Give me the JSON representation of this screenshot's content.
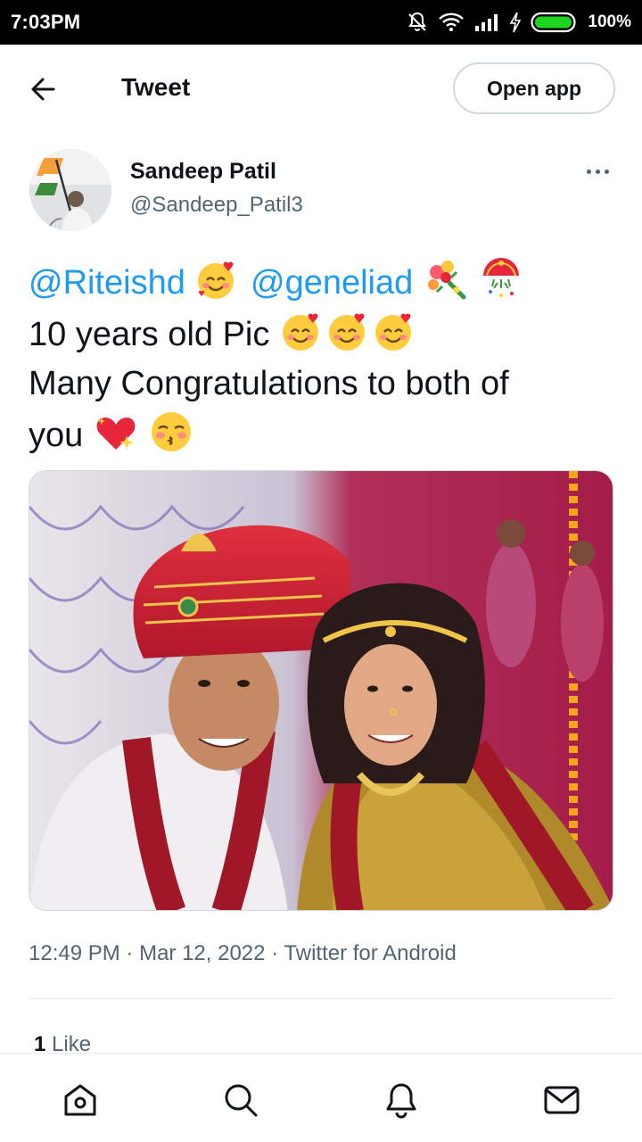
{
  "status_bar": {
    "time": "7:03PM",
    "battery": "100%"
  },
  "header": {
    "title": "Tweet",
    "open_app_label": "Open app"
  },
  "author": {
    "name": "Sandeep Patil",
    "handle": "@Sandeep_Patil3"
  },
  "tweet": {
    "mention_1": "@Riteishd",
    "mention_2": "@geneliad",
    "line_2": "10 years old Pic",
    "line_3": "Many Congratulations to both of",
    "line_4": "you"
  },
  "meta": {
    "time": "12:49 PM",
    "separator": "·",
    "date": "Mar 12, 2022",
    "source": "Twitter for Android"
  },
  "engagement": {
    "like_count": "1",
    "like_label": "Like"
  },
  "icons": {
    "back": "arrow-left-icon",
    "more": "more-horizontal-icon",
    "nav": [
      "home-icon",
      "search-icon",
      "notifications-icon",
      "messages-icon"
    ]
  },
  "colors": {
    "accent": "#1d9bf0",
    "text": "#0f1419",
    "secondary": "#536471"
  }
}
